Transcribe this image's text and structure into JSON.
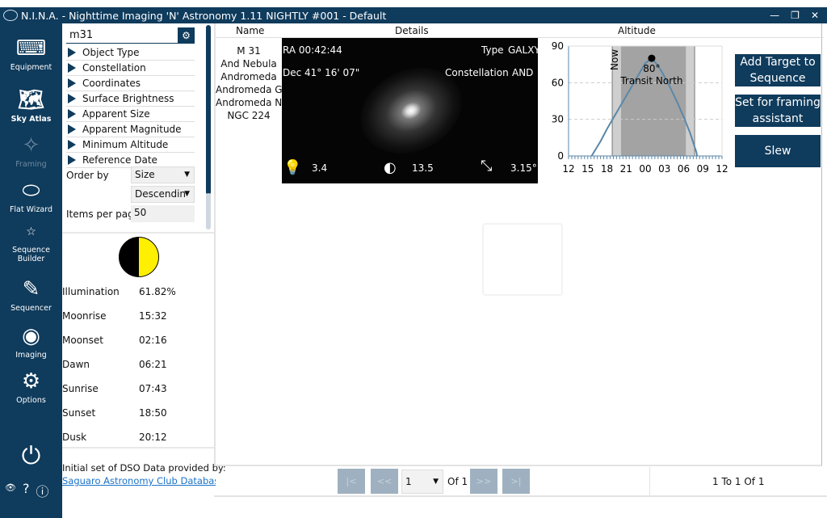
{
  "window": {
    "title": "N.I.N.A. - Nighttime Imaging 'N' Astronomy 1.11 NIGHTLY #001  -  Default",
    "controls": [
      "—",
      "❐",
      "✕"
    ]
  },
  "sidebar": {
    "items": [
      {
        "label": "Equipment",
        "icon": "equipment-icon",
        "glyph": "⌨"
      },
      {
        "label": "Sky Atlas",
        "icon": "sky-atlas-icon",
        "glyph": "🗺"
      },
      {
        "label": "Framing",
        "icon": "framing-icon",
        "glyph": "✧"
      },
      {
        "label": "Flat Wizard",
        "icon": "flat-wizard-icon",
        "glyph": "⬭"
      },
      {
        "label": "Sequence Builder",
        "icon": "sequence-builder-icon",
        "glyph": "☆"
      },
      {
        "label": "Sequencer",
        "icon": "sequencer-icon",
        "glyph": "✎"
      },
      {
        "label": "Imaging",
        "icon": "imaging-icon",
        "glyph": "◉"
      },
      {
        "label": "Options",
        "icon": "options-icon",
        "glyph": "⚙"
      }
    ],
    "power_glyph": "⏻",
    "bottom": [
      "👁",
      "?",
      "ⓘ"
    ]
  },
  "search": {
    "value": "m31"
  },
  "filters": [
    "Object Type",
    "Constellation",
    "Coordinates",
    "Surface Brightness",
    "Apparent Size",
    "Apparent Magnitude",
    "Minimum Altitude",
    "Reference Date"
  ],
  "order": {
    "label": "Order by",
    "field": "Size",
    "direction": "Descendin"
  },
  "items_per_page": {
    "label": "Items per page",
    "value": "50"
  },
  "moon": {
    "illumination_fraction": 0.6182,
    "rows": [
      {
        "label": "Illumination",
        "value": "61.82%"
      },
      {
        "label": "Moonrise",
        "value": "15:32"
      },
      {
        "label": "Moonset",
        "value": "02:16"
      },
      {
        "label": "Dawn",
        "value": "06:21"
      },
      {
        "label": "Sunrise",
        "value": "07:43"
      },
      {
        "label": "Sunset",
        "value": "18:50"
      },
      {
        "label": "Dusk",
        "value": "20:12"
      }
    ]
  },
  "credit": {
    "text": "Initial set of DSO Data provided by:",
    "link": "Saguaro Astronomy Club Database v"
  },
  "columns": {
    "name": "Name",
    "details": "Details",
    "altitude": "Altitude"
  },
  "result": {
    "names": [
      "M 31",
      "And Nebula",
      "Andromeda",
      "Andromeda Galaxy",
      "Andromeda Nebula",
      "NGC 224"
    ],
    "ra": "RA  00:42:44",
    "dec": "Dec 41° 16' 07\"",
    "type_label": "Type",
    "type": "GALXY",
    "const_label": "Constellation",
    "const": "AND",
    "magnitude": "3.4",
    "surface_brightness": "13.5",
    "size": "3.15°"
  },
  "chart_data": {
    "type": "line",
    "xlabel": "",
    "ylabel": "",
    "ylim": [
      0,
      90
    ],
    "yticks": [
      "0",
      "30",
      "60",
      "90"
    ],
    "xticks": [
      "12",
      "15",
      "18",
      "21",
      "00",
      "03",
      "06",
      "09",
      "12"
    ],
    "series": [
      {
        "x": [
          15.6,
          17,
          18,
          19,
          20,
          21,
          22,
          23,
          24,
          25,
          26,
          27,
          28,
          29,
          30,
          31,
          32,
          32.1
        ],
        "y": [
          0,
          12,
          22,
          31,
          40,
          49,
          58,
          67,
          76,
          80,
          74,
          65,
          55,
          44,
          32,
          19,
          3,
          0
        ]
      }
    ],
    "now_hour": 19.2,
    "night_dark": [
      20.2,
      30.35
    ],
    "twilight": [
      18.83,
      31.72
    ],
    "annotations": {
      "now": "Now",
      "peak": "80°",
      "transit": "Transit North"
    },
    "line_color": "#5b87a8"
  },
  "actions": [
    "Add Target to Sequence",
    "Set for framing assistant",
    "Slew"
  ],
  "pager": {
    "first": "|<",
    "prev": "<<",
    "page": "1",
    "of": "Of 1",
    "next": ">>",
    "last": ">|",
    "range": "1 To 1 Of 1"
  }
}
